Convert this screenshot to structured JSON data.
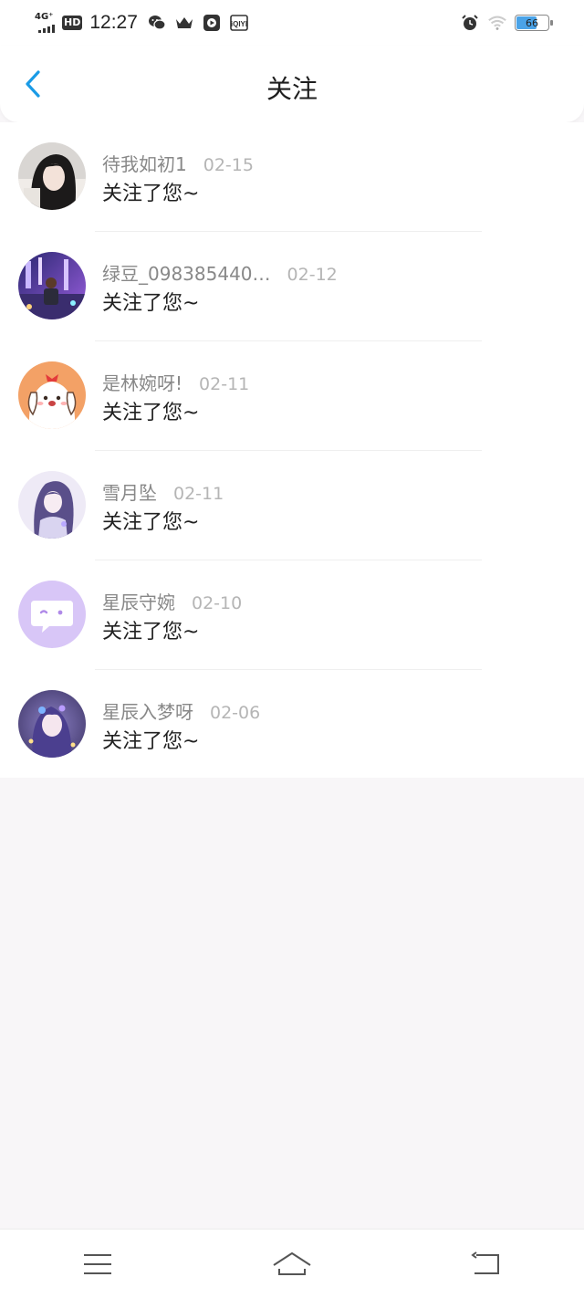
{
  "status_bar": {
    "network": "4G⁺",
    "hd": "HD",
    "time": "12:27",
    "battery": "66",
    "icons": [
      "wechat-icon",
      "crown-icon",
      "video-icon",
      "iqiyi-icon",
      "alarm-icon",
      "wifi-icon"
    ]
  },
  "header": {
    "title": "关注",
    "back_icon": "chevron-left-icon",
    "accent": "#1a9be6"
  },
  "notifications": [
    {
      "name": "待我如初1",
      "date": "02-15",
      "action": "关注了您~",
      "avatar": "photo-girl"
    },
    {
      "name": "绿豆_098385440…",
      "date": "02-12",
      "action": "关注了您~",
      "avatar": "photo-night"
    },
    {
      "name": "是林婉呀!",
      "date": "02-11",
      "action": "关注了您~",
      "avatar": "cartoon-dog"
    },
    {
      "name": "雪月坠",
      "date": "02-11",
      "action": "关注了您~",
      "avatar": "anime-girl"
    },
    {
      "name": "星辰守婉",
      "date": "02-10",
      "action": "关注了您~",
      "avatar": "default-chat"
    },
    {
      "name": "星辰入梦呀",
      "date": "02-06",
      "action": "关注了您~",
      "avatar": "anime-purple"
    }
  ],
  "nav_bar": {
    "icons": [
      "menu-icon",
      "home-icon",
      "back-icon"
    ]
  }
}
